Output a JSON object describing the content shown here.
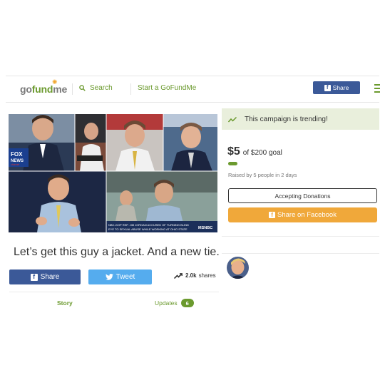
{
  "header": {
    "logo": {
      "go": "go",
      "fund": "fund",
      "me": "me"
    },
    "search_label": "Search",
    "start_label": "Start a GoFundMe",
    "share_label": "Share"
  },
  "campaign": {
    "title": "Let’s get this guy a jacket. And a new tie.",
    "image_caption": {
      "fox_line1": "FOX",
      "fox_line2": "NEWS",
      "fox_line3": "channel",
      "msnbc_line1": "NBC-GOP REP. JIM JORDAN ACCUSED OF TURNING BLIND",
      "msnbc_line2": "EYE TO SEXUAL ABUSE WHILE WORKING AT OHIO STATE",
      "msnbc_logo": "MSNBC"
    }
  },
  "share_bar": {
    "facebook_label": "Share",
    "twitter_label": "Tweet",
    "shares_count": "2.0k",
    "shares_suffix": "shares"
  },
  "tabs": {
    "story": "Story",
    "updates": "Updates",
    "updates_count": "6"
  },
  "sidebar": {
    "trending_text": "This campaign is trending!",
    "raised_amount": "$5",
    "goal_text": "of $200 goal",
    "progress_fraction": 0.025,
    "raised_by": "Raised by 5 people in 2 days",
    "accepting_label": "Accepting Donations",
    "share_fb_label": "Share on Facebook"
  },
  "colors": {
    "brand_green": "#6b9a2e",
    "facebook_blue": "#3b5998",
    "twitter_blue": "#55acee",
    "share_orange": "#f0a83a",
    "trending_bg": "#e9efdc"
  }
}
